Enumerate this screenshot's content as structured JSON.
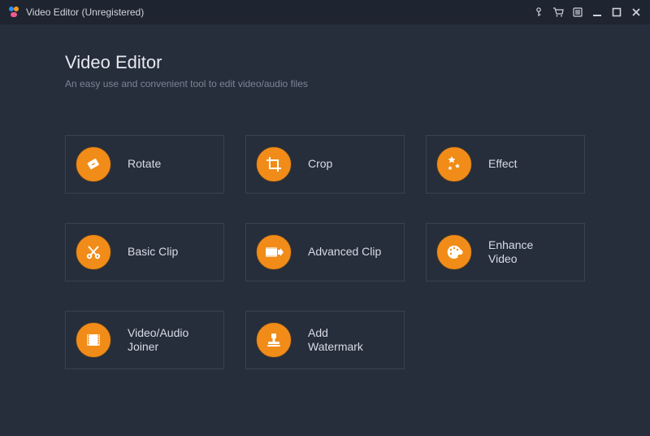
{
  "window": {
    "title": "Video Editor (Unregistered)"
  },
  "header": {
    "title": "Video Editor",
    "subtitle": "An easy use and convenient tool to edit video/audio files"
  },
  "tools": {
    "rotate": {
      "label": "Rotate"
    },
    "crop": {
      "label": "Crop"
    },
    "effect": {
      "label": "Effect"
    },
    "basic_clip": {
      "label": "Basic Clip"
    },
    "advanced_clip": {
      "label": "Advanced Clip"
    },
    "enhance_video": {
      "label": "Enhance\nVideo"
    },
    "joiner": {
      "label": "Video/Audio\nJoiner"
    },
    "watermark": {
      "label": "Add\nWatermark"
    }
  },
  "colors": {
    "accent": "#f18c18",
    "bg": "#262d3b",
    "titlebar_bg": "#1e2430",
    "card_border": "#3a4252"
  }
}
